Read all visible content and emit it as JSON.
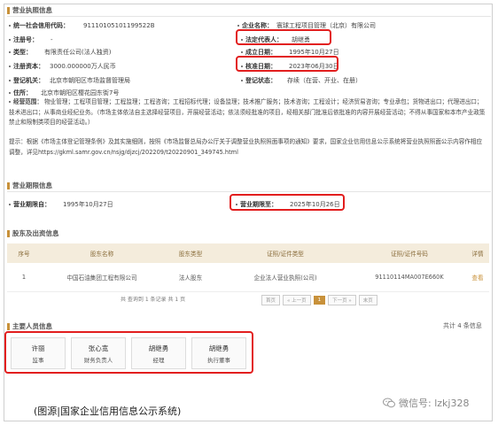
{
  "license_section": {
    "title": "营业执照信息",
    "fields": {
      "credit_code_label": "统一社会信用代码：",
      "credit_code_value": "91110105101199522B",
      "company_name_label": "企业名称：",
      "company_name_value": "寰球工程项目管理（北京）有限公司",
      "reg_no_label": "注册号：",
      "reg_no_value": "-",
      "legal_rep_label": "法定代表人：",
      "legal_rep_value": "胡继勇",
      "type_label": "类型：",
      "type_value": "有限责任公司(法人独资)",
      "established_label": "成立日期：",
      "established_value": "1995年10月27日",
      "capital_label": "注册资本：",
      "capital_value": "3000.000000万人民币",
      "approval_label": "核准日期：",
      "approval_value": "2023年06月30日",
      "authority_label": "登记机关：",
      "authority_value": "北京市朝阳区市场监督管理局",
      "status_label": "登记状态：",
      "status_value": "存续（在营、开业、在册）",
      "address_label": "住所：",
      "address_value": "北京市朝阳区樱花园东街7号"
    },
    "scope_label": "经营范围：",
    "scope_text": "物业管理；工程项目管理；工程监理；工程咨询；工程招标代理；设备监理；技术推广服务；技术咨询；工程设计；经济贸易咨询；专业承包；货物进出口；代理进出口；技术进出口；从事商业经纪业务。（市场主体依法自主选择经营项目，开展经营活动；依法须经批准的项目，经相关部门批准后依批准的内容开展经营活动；不得从事国家和本市产业政策禁止和限制类项目的经营活动。）",
    "notice_text": "提示：根据《市场主体登记管理条例》及其实施细则，按照《市场监督总局办公厅关于调整营业执照照面事项的通知》要求，国家企业信用信息公示系统将营业执照照面公示内容作相应调整，详见https://gkml.samr.gov.cn/nsjg/djzcj/202209/t20220901_349745.html"
  },
  "term_section": {
    "title": "营业期限信息",
    "from_label": "营业期限自：",
    "from_value": "1995年10月27日",
    "to_label": "营业期限至：",
    "to_value": "2025年10月26日"
  },
  "shareholder_section": {
    "title": "股东及出资信息",
    "columns": [
      "序号",
      "股东名称",
      "股东类型",
      "证照/证件类型",
      "证照/证件号码",
      "详情"
    ],
    "rows": [
      {
        "no": "1",
        "name": "中国石油集团工程有限公司",
        "type": "法人股东",
        "id_type": "企业法人营业执照(公司)",
        "id_no": "91110114MA007E660K",
        "detail": "查看"
      }
    ],
    "pager": {
      "summary": "共 查询到 1 条记录 共 1 页",
      "first": "首页",
      "prev": "« 上一页",
      "current": "1",
      "next": "下一页 »",
      "last": "末页"
    }
  },
  "personnel_section": {
    "title": "主要人员信息",
    "count_text": "共计 4 条信息",
    "people": [
      {
        "name": "许丽",
        "role": "监事"
      },
      {
        "name": "张心宽",
        "role": "财务负责人"
      },
      {
        "name": "胡继勇",
        "role": "经理"
      },
      {
        "name": "胡继勇",
        "role": "执行董事"
      }
    ]
  },
  "caption": "(图源|国家企业信用信息公示系统)",
  "watermark": "微信号: lzkj328",
  "colors": {
    "accent": "#c8913a",
    "highlight": "#e21e1e"
  }
}
